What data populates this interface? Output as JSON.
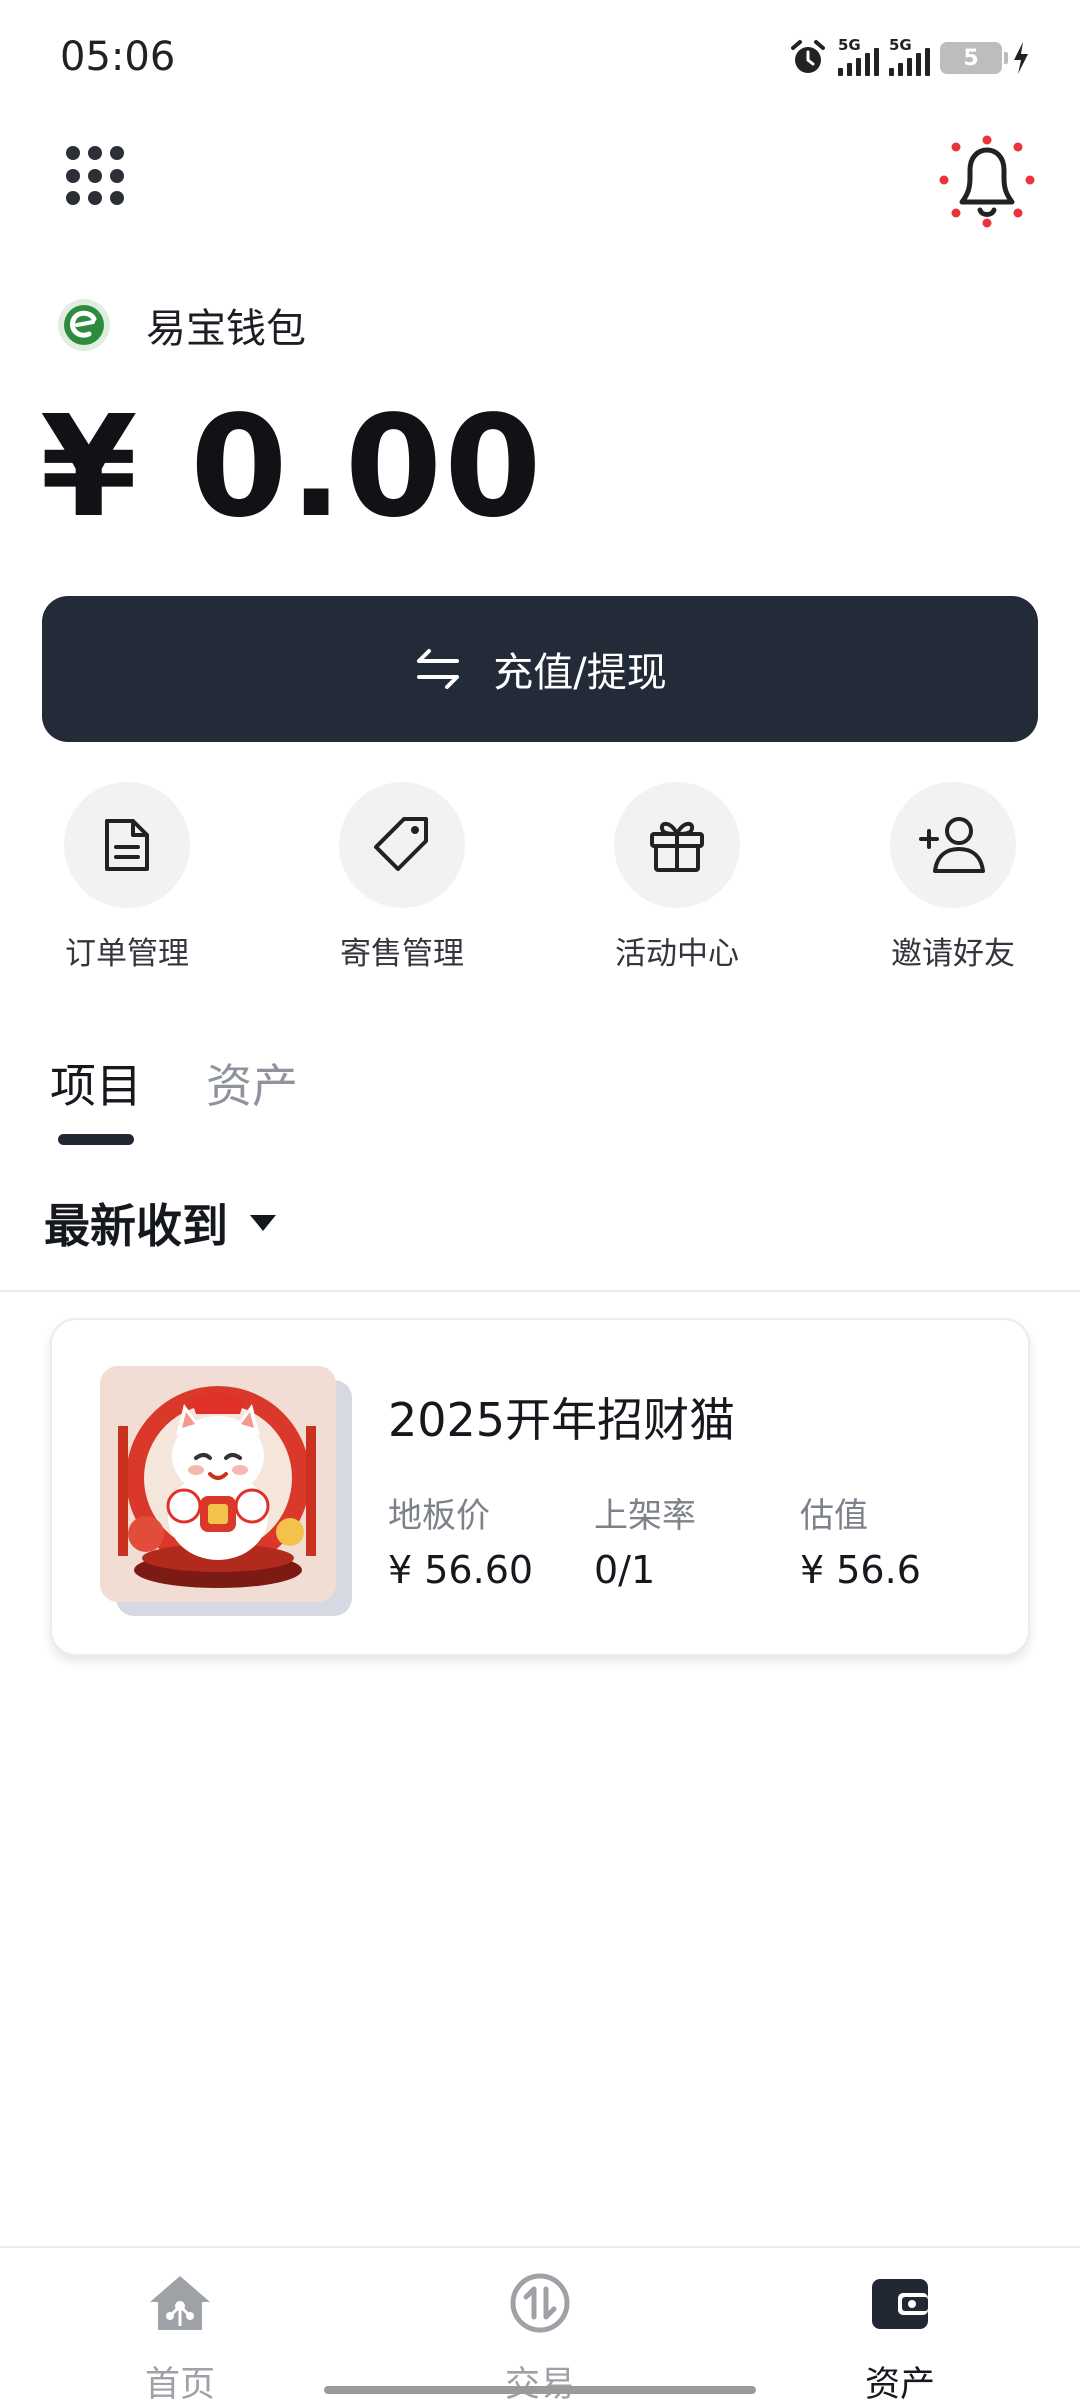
{
  "status_bar": {
    "time": "05:06",
    "network_1": "5G",
    "network_2": "5G",
    "battery": "5",
    "icons": [
      "alarm-icon",
      "signal-icon",
      "signal-icon",
      "battery-icon",
      "charging-icon"
    ]
  },
  "header": {
    "menu_icon": "grid-icon",
    "notification_icon": "bell-icon",
    "notification_dot_color": "#e8343a"
  },
  "brand": {
    "name": "易宝钱包",
    "logo_color": "#2e8b3e"
  },
  "balance": "¥ 0.00",
  "recharge_button": {
    "label": "充值/提现",
    "icon": "swap-arrows-icon",
    "background": "#232a38"
  },
  "quick_actions": [
    {
      "label": "订单管理",
      "icon": "document-icon"
    },
    {
      "label": "寄售管理",
      "icon": "tag-icon"
    },
    {
      "label": "活动中心",
      "icon": "gift-icon"
    },
    {
      "label": "邀请好友",
      "icon": "add-user-icon"
    }
  ],
  "tabs": [
    {
      "label": "项目",
      "active": true
    },
    {
      "label": "资产",
      "active": false
    }
  ],
  "sort": {
    "label": "最新收到",
    "icon": "caret-down-icon"
  },
  "items": [
    {
      "title": "2025开年招财猫",
      "image": "lucky-cat-image",
      "stats": [
        {
          "label": "地板价",
          "value": "¥ 56.60"
        },
        {
          "label": "上架率",
          "value": "0/1"
        },
        {
          "label": "估值",
          "value": "¥ 56.6"
        }
      ]
    }
  ],
  "bottom_nav": [
    {
      "label": "首页",
      "icon": "home-icon",
      "active": false
    },
    {
      "label": "交易",
      "icon": "trade-icon",
      "active": false
    },
    {
      "label": "资产",
      "icon": "wallet-icon",
      "active": true
    }
  ],
  "colors": {
    "primary_dark": "#232a38",
    "inactive_text": "#8f949c",
    "nav_inactive": "#9ea1a6"
  }
}
